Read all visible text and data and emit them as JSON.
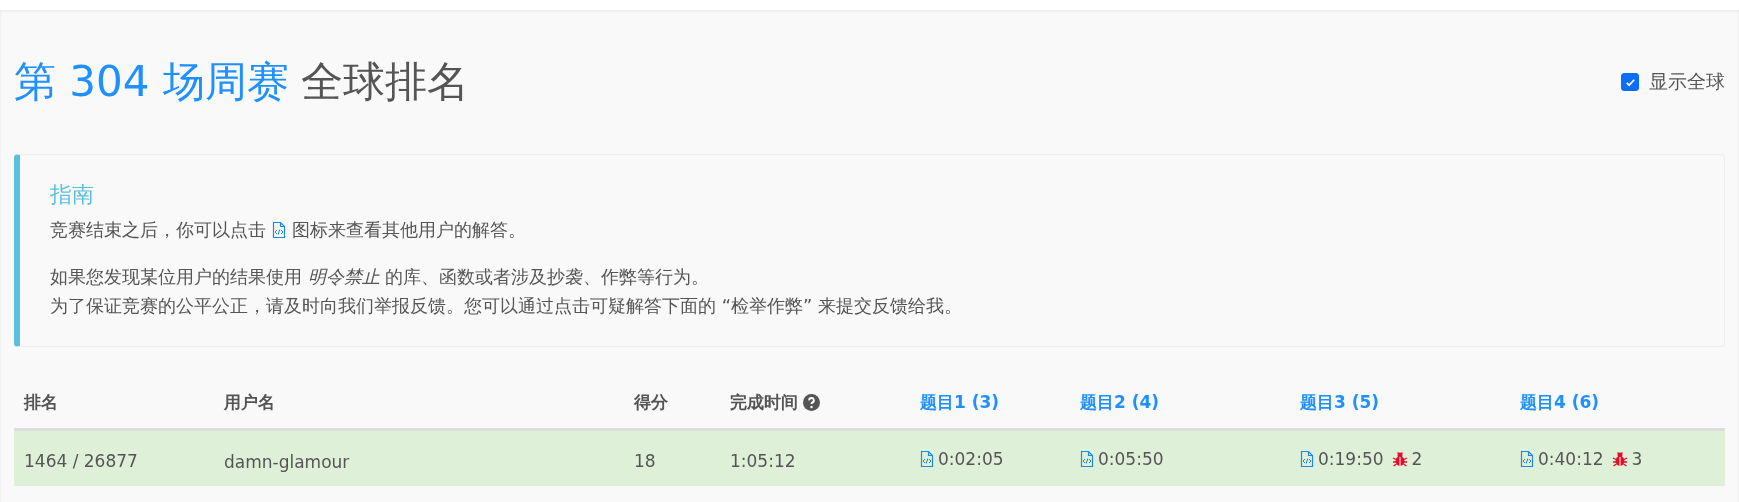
{
  "title": {
    "contest": "第 304 场周赛",
    "suffix": "全球排名"
  },
  "show_global": {
    "label": "显示全球",
    "checked": true
  },
  "guide": {
    "heading": "指南",
    "line_before_icon": "竞赛结束之后，你可以点击",
    "line_after_icon": "图标来查看其他用户的解答。",
    "paragraph": [
      "如果您发现某位用户的结果使用 *明令禁止* 的库、函数或者涉及抄袭、作弊等行为。",
      "为了保证竞赛的公平公正，请及时向我们举报反馈。您可以通过点击可疑解答下面的 “检举作弊” 来提交反馈给我。"
    ]
  },
  "table": {
    "columns": [
      {
        "label": "排名",
        "kind": "plain"
      },
      {
        "label": "用户名",
        "kind": "plain"
      },
      {
        "label": "得分",
        "kind": "plain"
      },
      {
        "label": "完成时间",
        "kind": "help"
      },
      {
        "label": "题目1 (3)",
        "kind": "link"
      },
      {
        "label": "题目2 (4)",
        "kind": "link"
      },
      {
        "label": "题目3 (5)",
        "kind": "link"
      },
      {
        "label": "题目4 (6)",
        "kind": "link"
      }
    ],
    "rows": [
      {
        "rank": "1464 / 26877",
        "username": "damn-glamour",
        "score": "18",
        "finish_time": "1:05:12",
        "problems": [
          {
            "time": "0:02:05"
          },
          {
            "time": "0:05:50"
          },
          {
            "time": "0:19:50",
            "bugs": "2"
          },
          {
            "time": "0:40:12",
            "bugs": "3"
          }
        ]
      }
    ]
  }
}
